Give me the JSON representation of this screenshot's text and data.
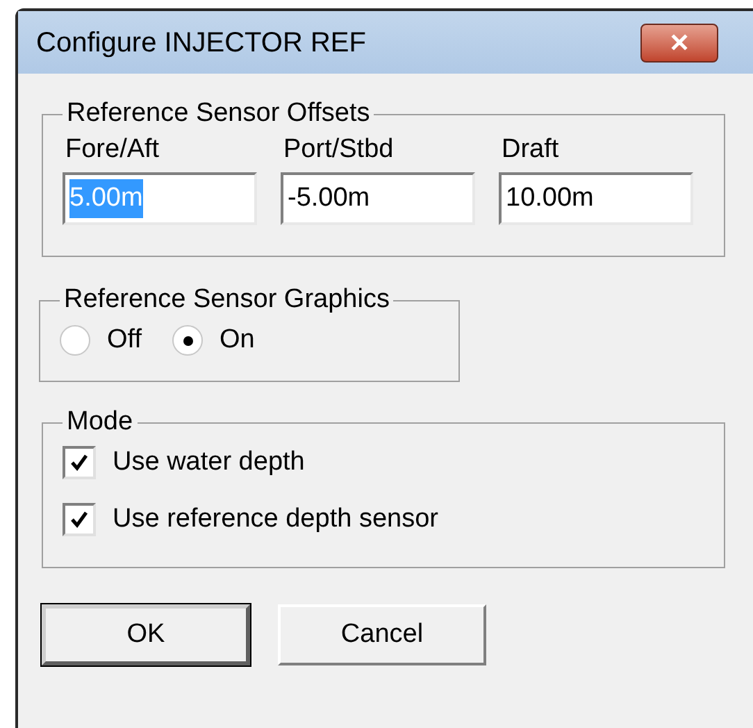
{
  "window": {
    "title": "Configure INJECTOR REF",
    "close_symbol": "✕"
  },
  "offsets": {
    "title": "Reference Sensor Offsets",
    "fields": [
      {
        "label": "Fore/Aft",
        "value": "5.00m",
        "text_selected": true
      },
      {
        "label": "Port/Stbd",
        "value": "-5.00m",
        "text_selected": false
      },
      {
        "label": "Draft",
        "value": "10.00m",
        "text_selected": false
      }
    ]
  },
  "graphics": {
    "title": "Reference Sensor Graphics",
    "options": [
      {
        "label": "Off",
        "selected": false
      },
      {
        "label": "On",
        "selected": true
      }
    ]
  },
  "mode": {
    "title": "Mode",
    "options": [
      {
        "label": "Use water depth",
        "checked": true
      },
      {
        "label": "Use reference depth sensor",
        "checked": true
      }
    ]
  },
  "buttons": [
    {
      "label": "OK",
      "default": true
    },
    {
      "label": "Cancel",
      "default": false
    }
  ]
}
